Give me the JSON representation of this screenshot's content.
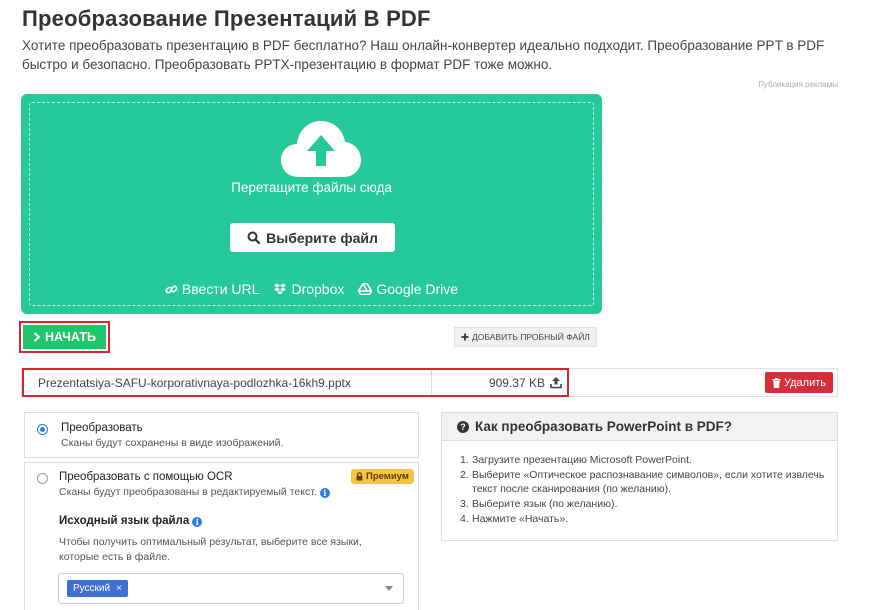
{
  "page": {
    "title": "Преобразование Презентаций В PDF",
    "description": "Хотите преобразовать презентацию в PDF бесплатно? Наш онлайн-конвертер идеально подходит. Преобразование PPT в PDF быстро и безопасно. Преобразовать PPTX-презентацию в формат PDF тоже можно.",
    "ads_note": "Публикация рекламы"
  },
  "dropzone": {
    "drop_text": "Перетащите файлы сюда",
    "choose_label": "Выберите файл",
    "sources": {
      "url": "Ввести URL",
      "dropbox": "Dropbox",
      "gdrive": "Google Drive"
    },
    "color": "#25c99a"
  },
  "actions": {
    "start_label": "НАЧАТЬ",
    "sample_label": "ДОБАВИТЬ ПРОБНЫЙ ФАЙЛ"
  },
  "file": {
    "name": "Prezentatsiya-SAFU-korporativnaya-podlozhka-16kh9.pptx",
    "size": "909.37 KB",
    "delete_label": "Удалить"
  },
  "options": {
    "convert": {
      "title": "Преобразовать",
      "subtitle": "Сканы будут сохранены в виде изображений.",
      "checked": true
    },
    "ocr": {
      "title": "Преобразовать с помощью OCR",
      "subtitle": "Сканы будут преобразованы в редактируемый текст.",
      "premium": "Премиум",
      "checked": false
    },
    "language": {
      "heading": "Исходный язык файла",
      "hint": "Чтобы получить оптимальный результат, выберите все языки, которые есть в файле.",
      "selected": "Русский",
      "remove": "×"
    }
  },
  "howto": {
    "title": "Как преобразовать PowerPoint в PDF?",
    "steps": [
      "Загрузите презентацию Microsoft PowerPoint.",
      "Выберите «Оптическое распознавание символов», если хотите извлечь текст после сканирования (по желанию).",
      "Выберите язык (по желанию).",
      "Нажмите «Начать»."
    ]
  },
  "colors": {
    "start_green": "#1ec66c",
    "highlight_red": "#d9252c",
    "delete_red": "#d42f3a",
    "premium_yellow": "#f6c244",
    "chip_blue": "#3f6fd6"
  }
}
